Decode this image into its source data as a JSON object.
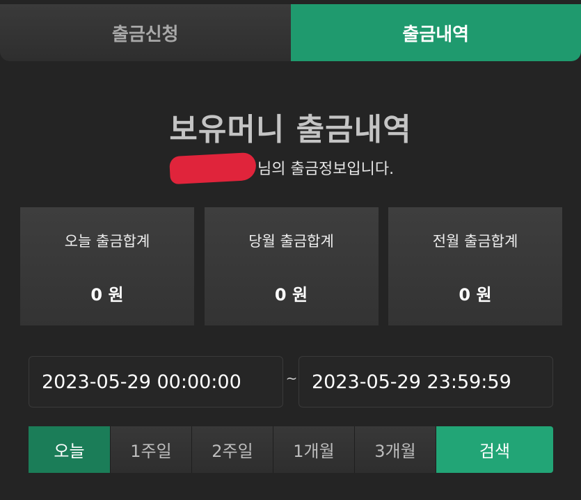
{
  "tabs": [
    {
      "label": "출금신청",
      "active": false
    },
    {
      "label": "출금내역",
      "active": true
    }
  ],
  "header": {
    "title": "보유머니 출금내역",
    "subtitle_suffix": "님의 출금정보입니다."
  },
  "summary": [
    {
      "label": "오늘 출금합계",
      "value": "0 원"
    },
    {
      "label": "당월 출금합계",
      "value": "0 원"
    },
    {
      "label": "전월 출금합계",
      "value": "0 원"
    }
  ],
  "date_range": {
    "start": "2023-05-29 00:00:00",
    "separator": "~",
    "end": "2023-05-29 23:59:59"
  },
  "periods": [
    {
      "label": "오늘",
      "active": true
    },
    {
      "label": "1주일",
      "active": false
    },
    {
      "label": "2주일",
      "active": false
    },
    {
      "label": "1개월",
      "active": false
    },
    {
      "label": "3개월",
      "active": false
    }
  ],
  "search_label": "검색",
  "colors": {
    "accent": "#1f9a6e",
    "active_period": "#1b7d58",
    "search": "#22a576",
    "background": "#242424",
    "redaction": "#e0243b"
  }
}
